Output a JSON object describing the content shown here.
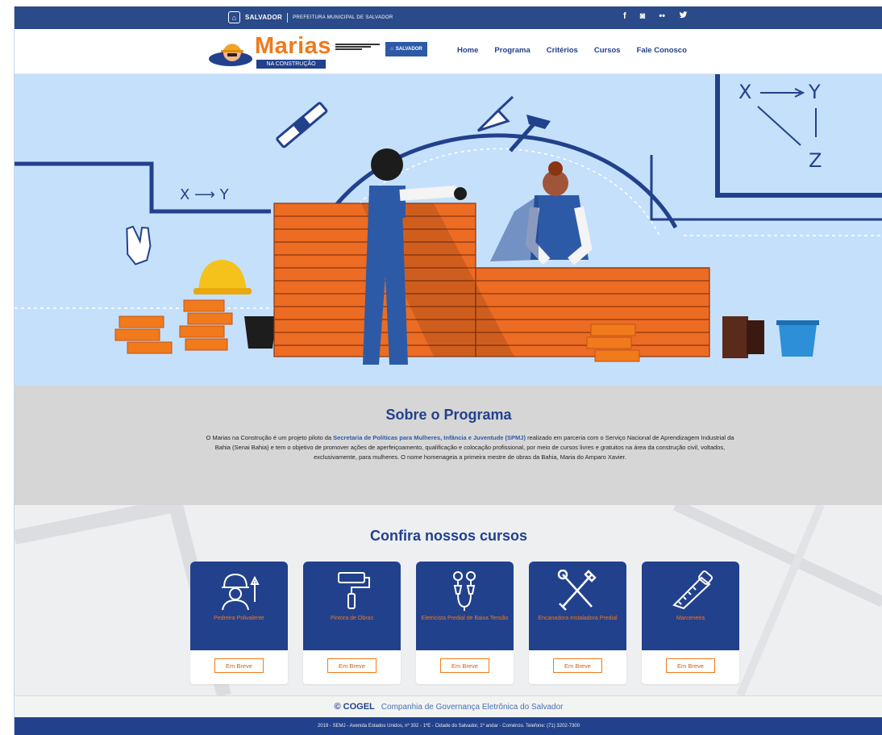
{
  "topbar": {
    "gov_brand": "SALVADOR",
    "gov_slogan": "PREFEITURA MUNICIPAL DE SALVADOR",
    "social": [
      "f",
      "◙",
      "••",
      "♥"
    ]
  },
  "nav": {
    "logo_word": "Marias",
    "logo_sub": "NA CONSTRUÇÃO",
    "salvador_badge": "SALVADOR",
    "menu": [
      "Home",
      "Programa",
      "Critérios",
      "Cursos",
      "Fale Conosco"
    ]
  },
  "hero": {
    "label_xy": "X ⟶ Y",
    "label_x": "X",
    "label_y": "Y",
    "label_z": "Z"
  },
  "about": {
    "title": "Sobre o Programa",
    "text_before": "O Marias na Construção é um projeto piloto da ",
    "text_highlight": "Secretaria de Políticas para Mulheres, Infância e Juventude (SPMJ)",
    "text_after": " realizado em parceria com o Serviço Nacional de Aprendizagem Industrial da Bahia (Senai Bahia) e tem o objetivo de promover ações de aperfeiçoamento, qualificação e colocação profissional, por meio de cursos livres e gratuitos na área da construção civil, voltados, exclusivamente, para mulheres. O nome homenageia a primeira mestre de obras da Bahia, Maria do Amparo Xavier."
  },
  "courses": {
    "title": "Confira nossos cursos",
    "items": [
      {
        "title": "Pedreira Polivalente",
        "button": "Em Breve",
        "icon": "worker-icon"
      },
      {
        "title": "Pintora de Obras",
        "button": "Em Breve",
        "icon": "paint-roller-icon"
      },
      {
        "title": "Eletricista Predial de Baixa Tensão",
        "button": "Em Breve",
        "icon": "electric-plug-icon"
      },
      {
        "title": "Encanadora Instaladora Predial",
        "button": "Em Breve",
        "icon": "wrench-icon"
      },
      {
        "title": "Marceneira",
        "button": "Em Breve",
        "icon": "saw-icon"
      }
    ]
  },
  "footer": {
    "cogel_mark": "© COGEL",
    "cogel_name": "Companhia de Governança Eletrônica do Salvador",
    "bottom_text": "2019 - SEMJ - Avenida Estados Unidos, nº 302 - 1ºE - Cidade do Salvador, 1º andar - Comércio. Telefone: (71) 3202-7300"
  },
  "colors": {
    "primary": "#22418c",
    "accent": "#f07a1c",
    "hero_bg": "#c5e0fb",
    "about_bg": "#d6d6d6"
  }
}
